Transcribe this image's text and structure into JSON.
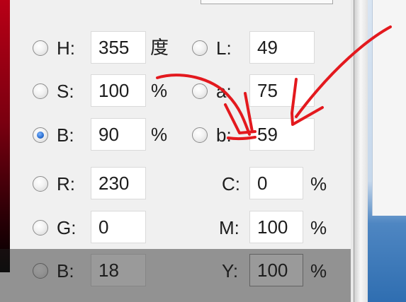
{
  "hsb": {
    "h": {
      "label": "H:",
      "value": "355",
      "unit": "度",
      "selected": false
    },
    "s": {
      "label": "S:",
      "value": "100",
      "unit": "%",
      "selected": false
    },
    "b": {
      "label": "B:",
      "value": "90",
      "unit": "%",
      "selected": true
    }
  },
  "lab": {
    "l": {
      "label": "L:",
      "value": "49",
      "selected": false
    },
    "a": {
      "label": "a:",
      "value": "75",
      "selected": false
    },
    "b": {
      "label": "b:",
      "value": "59",
      "selected": false
    }
  },
  "rgb": {
    "r": {
      "label": "R:",
      "value": "230",
      "selected": false
    },
    "g": {
      "label": "G:",
      "value": "0",
      "selected": false
    },
    "b": {
      "label": "B:",
      "value": "18",
      "selected": false
    }
  },
  "cmyk": {
    "c": {
      "label": "C:",
      "value": "0",
      "unit": "%"
    },
    "m": {
      "label": "M:",
      "value": "100",
      "unit": "%"
    },
    "y": {
      "label": "Y:",
      "value": "100",
      "unit": "%"
    }
  },
  "colors": {
    "annotation": "#e3191e",
    "radio_selected": "#2a6fd1"
  }
}
